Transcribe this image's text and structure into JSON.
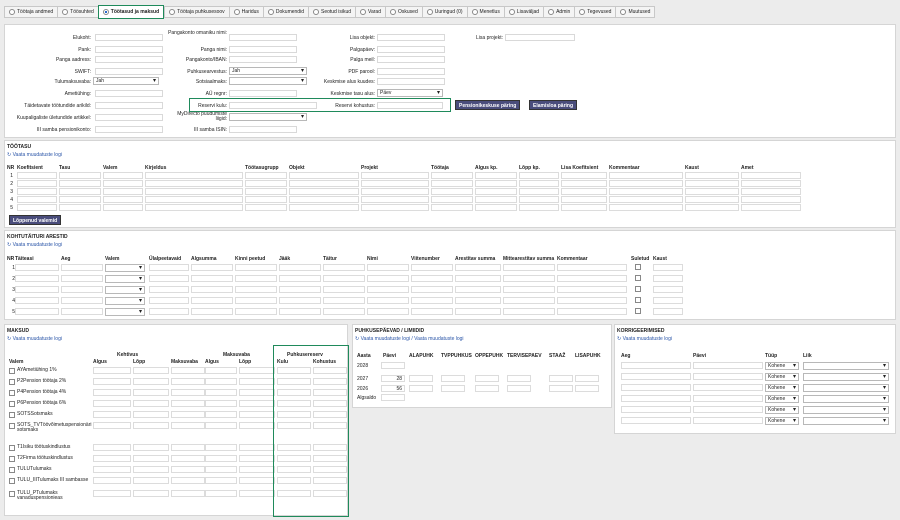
{
  "tabs": [
    {
      "label": "Töötaja andmed",
      "active": false
    },
    {
      "label": "Töösuhted",
      "active": false
    },
    {
      "label": "Töötasud ja maksud",
      "active": true
    },
    {
      "label": "Töötaja puhkusesoov",
      "active": false
    },
    {
      "label": "Haridus",
      "active": false
    },
    {
      "label": "Dokumendid",
      "active": false
    },
    {
      "label": "Seotud isikud",
      "active": false
    },
    {
      "label": "Varad",
      "active": false
    },
    {
      "label": "Oskused",
      "active": false
    },
    {
      "label": "Uuringud (0)",
      "active": false
    },
    {
      "label": "Menetlus",
      "active": false
    },
    {
      "label": "Lisaväljad",
      "active": false
    },
    {
      "label": "Admin",
      "active": false
    },
    {
      "label": "Tegevused",
      "active": false
    },
    {
      "label": "Muutused",
      "active": false
    }
  ],
  "form": {
    "elukoht": "Elukoht:",
    "pank": "Pank:",
    "panga_aadress": "Panga aadress:",
    "swift": "SWIFT:",
    "tulumaksuvaba": "Tulumaksuvaba:",
    "tulumaksuvaba_val": "Jah",
    "ametiyhing": "Ametiühing:",
    "taidetavate": "Täidetavate töötundide arikild:",
    "kuupaligaliste": "Kuupaligaliste ületundide artikkel:",
    "iii_samba_konto": "III samba pensionikonto:",
    "pangakonto_omaniku": "Pangakonto omaniku nimi:",
    "panga_nimi": "Panga nimi:",
    "pangakonto_iban": "Pangakonto/IBAN:",
    "puhkusearvestus": "Puhkusearvestus:",
    "puhkusearvestus_val": "Jah",
    "sotsiaalmaks": "Sotsiaalmaks:",
    "ay_regnr": "AÜ regnr:",
    "reserv_kulu": "Reservi kulu:",
    "mydirecto": "MyDirecto puudumiste liigid:",
    "iii_samba_isin": "III samba ISIN:",
    "lisa_objekt": "Lisa objekt:",
    "palgapaev": "Palgapäev:",
    "palga_meil": "Palga meil:",
    "pdf_parool": "PDF parool:",
    "keskmise_alus_kuudes": "Keskmise alus kuudes:",
    "keskmise_tasu_alus": "Keskmise tasu alus:",
    "keskmise_tasu_alus_val": "Päev",
    "reservi_kohustus": "Reservi kohustus:",
    "lisa_projekt": "Lisa projekt:",
    "pensionikeskuse_btn": "Pensionikeskuse päring",
    "elamisloa_btn": "Elamisloa päring"
  },
  "tootasu": {
    "title": "TÖÖTASU",
    "log": "Vaata muudatuste logi",
    "headers": [
      "NR",
      "Koefitsient",
      "Tasu",
      "Valem",
      "Kirjeldus",
      "Töötasugrupp",
      "Objekt",
      "Projekt",
      "Töötaja",
      "Algus kp.",
      "Lõpp kp.",
      "Lisa Koefitsient",
      "Kommentaar",
      "Kaust",
      "Amet"
    ],
    "rows": [
      "1",
      "2",
      "3",
      "4",
      "5"
    ],
    "button": "Lõppenud valemid"
  },
  "kohtutaituri": {
    "title": "KOHTUTÄITURI ARESTID",
    "log": "Vaata muudatuste logi",
    "headers": [
      "NR",
      "Täiteasi",
      "Aeg",
      "Valem",
      "Ülalpeetavaid",
      "Algsumma",
      "Kinni peetud",
      "Jääk",
      "Täitur",
      "Nimi",
      "Viitenumber",
      "Arestitav summa",
      "Mittearestitav summa",
      "Kommentaar",
      "Suletud",
      "Kaust"
    ],
    "rows": [
      "1",
      "2",
      "3",
      "4",
      "5"
    ]
  },
  "maksud": {
    "title": "MAKSUD",
    "log": "Vaata muudatuste logi",
    "group_kehtivus": "Kehtivus",
    "group_maksuvaba": "Maksuvaba",
    "group_puhkusereserv": "Puhkusereserv",
    "headers": [
      "Valem",
      "Algus",
      "Lõpp",
      "Maksuvaba",
      "Algus",
      "Lõpp",
      "Kulu",
      "Kohustus"
    ],
    "items": [
      "AYAmetiühing 1%",
      "P2Pension töötaja 2%",
      "P4Pension töötaja 4%",
      "P6Pension töötaja 6%",
      "SOTSSotsmaks",
      "SOTS_TVTöövõimetuspensionäri sotsmaks",
      "T1Isiku töötuskindlustus",
      "T2Firma töötuskindlustus",
      "TULUTulumaks",
      "TULU_IIITulumaks III sambasse",
      "TULU_PTulumaks vanaduspensionieas"
    ]
  },
  "puhkus": {
    "title": "PUHKUSEPÄEVAD / LIMIIDID",
    "log": "Vaata muudatuste logi / Vaata muudatuste logi",
    "headers": [
      "Aasta",
      "Päevi",
      "ALAPUHK",
      "TVPPUHKUS",
      "OPPEPUHK",
      "TERVISEPAEV",
      "STAAŽ",
      "LISAPUHK"
    ],
    "rows": [
      {
        "year": "2028",
        "days": ""
      },
      {
        "year": "2027",
        "days": "28"
      },
      {
        "year": "2026",
        "days": "56"
      },
      {
        "year": "Algsaldo",
        "days": ""
      }
    ]
  },
  "korrigeerimised": {
    "title": "KORRIGEERIMISED",
    "log": "Vaata muudatuste logi",
    "headers": [
      "Aeg",
      "Päevi",
      "Tüüp",
      "Liik"
    ],
    "type_val": "Kohene",
    "rows": 6
  }
}
